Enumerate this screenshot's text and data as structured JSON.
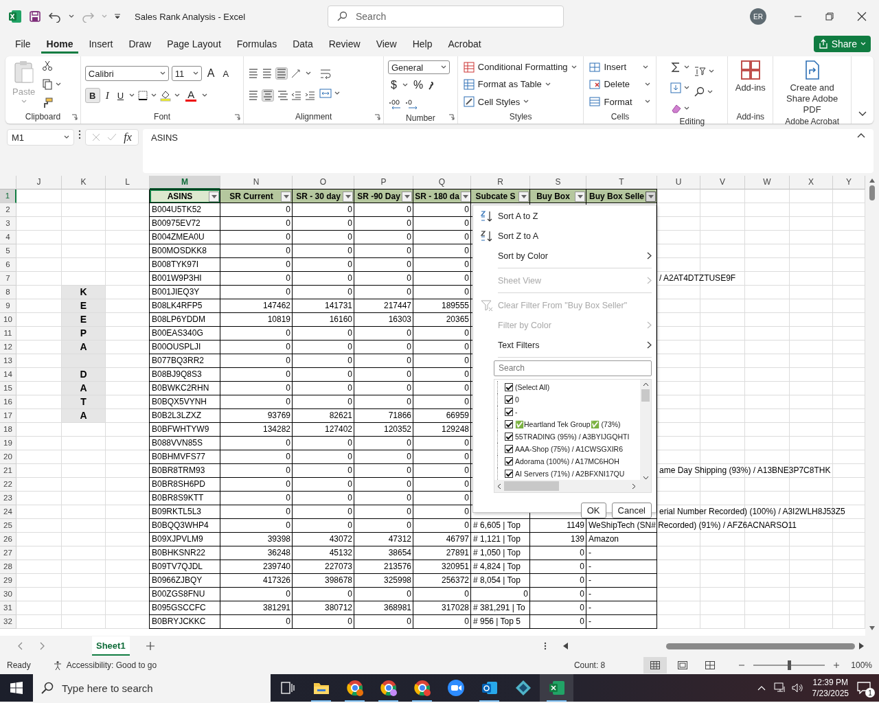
{
  "window": {
    "title": "Sales Rank Analysis - Excel",
    "search_placeholder": "Search",
    "account_initials": "ER"
  },
  "ribbon_tabs": [
    {
      "label": "File",
      "selected": false
    },
    {
      "label": "Home",
      "selected": true
    },
    {
      "label": "Insert",
      "selected": false
    },
    {
      "label": "Draw",
      "selected": false
    },
    {
      "label": "Page Layout",
      "selected": false
    },
    {
      "label": "Formulas",
      "selected": false
    },
    {
      "label": "Data",
      "selected": false
    },
    {
      "label": "Review",
      "selected": false
    },
    {
      "label": "View",
      "selected": false
    },
    {
      "label": "Help",
      "selected": false
    },
    {
      "label": "Acrobat",
      "selected": false
    }
  ],
  "share_button": "Share",
  "ribbon": {
    "clipboard": {
      "paste": "Paste",
      "paste_disabled": true,
      "label": "Clipboard"
    },
    "font": {
      "name": "Calibri",
      "size": "11",
      "grow": "A",
      "shrink": "A",
      "bold": "B",
      "italic": "I",
      "underline": "U",
      "font_color": "A",
      "label": "Font"
    },
    "alignment": {
      "label": "Alignment"
    },
    "number": {
      "format": "General",
      "currency": "$",
      "percent": "%",
      "label": "Number"
    },
    "styles": {
      "buttons": [
        "Conditional Formatting",
        "Format as Table",
        "Cell Styles"
      ],
      "label": "Styles"
    },
    "cells": {
      "buttons": [
        "Insert",
        "Delete",
        "Format"
      ],
      "label": "Cells"
    },
    "editing": {
      "label": "Editing"
    },
    "addins": {
      "button": "Add-ins",
      "label": "Add-ins"
    },
    "acrobat": {
      "button": "Create and Share Adobe PDF",
      "label": "Adobe Acrobat"
    }
  },
  "formula_bar": {
    "name_box": "M1",
    "function_label": "fx",
    "formula": "ASINS"
  },
  "sheet": {
    "columns": [
      {
        "label": "J",
        "selected": false
      },
      {
        "label": "K",
        "selected": false
      },
      {
        "label": "L",
        "selected": false
      },
      {
        "label": "M",
        "selected": true
      },
      {
        "label": "N",
        "selected": false
      },
      {
        "label": "O",
        "selected": false
      },
      {
        "label": "P",
        "selected": false
      },
      {
        "label": "Q",
        "selected": false
      },
      {
        "label": "R",
        "selected": false
      },
      {
        "label": "S",
        "selected": false
      },
      {
        "label": "T",
        "selected": false
      },
      {
        "label": "U",
        "selected": false
      },
      {
        "label": "V",
        "selected": false
      },
      {
        "label": "W",
        "selected": false
      },
      {
        "label": "X",
        "selected": false
      },
      {
        "label": "Y",
        "selected": false
      }
    ],
    "header_row": {
      "number": "1",
      "selected": true,
      "cells": [
        {
          "text": "ASINS",
          "active": true,
          "filter_open": false
        },
        {
          "text": "SR Current",
          "active": false,
          "filter_open": false
        },
        {
          "text": "SR - 30 day",
          "active": false,
          "filter_open": false
        },
        {
          "text": "SR -90 Day",
          "active": false,
          "filter_open": false
        },
        {
          "text": "SR - 180 da",
          "active": false,
          "filter_open": false
        },
        {
          "text": "Subcate S",
          "active": false,
          "filter_open": false
        },
        {
          "text": "Buy Box",
          "active": false,
          "filter_open": false
        },
        {
          "text": "Buy Box Selle",
          "active": false,
          "filter_open": true
        }
      ]
    },
    "rows": [
      {
        "number": "2",
        "selected": false,
        "shaded": false,
        "cells": {
          "m": "B004U5TK52",
          "n": "0",
          "o": "0",
          "p": "0",
          "q": "0"
        }
      },
      {
        "number": "3",
        "selected": false,
        "shaded": false,
        "cells": {
          "m": "B00975EV72",
          "n": "0",
          "o": "0",
          "p": "0",
          "q": "0"
        }
      },
      {
        "number": "4",
        "selected": false,
        "shaded": false,
        "cells": {
          "m": "B004ZMEA0U",
          "n": "0",
          "o": "0",
          "p": "0",
          "q": "0"
        }
      },
      {
        "number": "5",
        "selected": false,
        "shaded": false,
        "cells": {
          "m": "B00MOSDKK8",
          "n": "0",
          "o": "0",
          "p": "0",
          "q": "0"
        }
      },
      {
        "number": "6",
        "selected": false,
        "shaded": false,
        "cells": {
          "m": "B008TYK97I",
          "n": "0",
          "o": "0",
          "p": "0",
          "q": "0"
        }
      },
      {
        "number": "7",
        "selected": false,
        "shaded": false,
        "cells": {
          "m": "B001W9P3HI",
          "n": "0",
          "o": "0",
          "p": "0",
          "q": "0",
          "u": "/ A2AT4DTZTUSE9F"
        }
      },
      {
        "number": "8",
        "selected": false,
        "shaded": true,
        "cells": {
          "k": "K",
          "m": "B001JIEQ3Y",
          "n": "0",
          "o": "0",
          "p": "0",
          "q": "0"
        }
      },
      {
        "number": "9",
        "selected": false,
        "shaded": true,
        "cells": {
          "k": "E",
          "m": "B08LK4RFP5",
          "n": "147462",
          "o": "141731",
          "p": "217447",
          "q": "189555"
        }
      },
      {
        "number": "10",
        "selected": false,
        "shaded": true,
        "cells": {
          "k": "E",
          "m": "B08LP6YDDM",
          "n": "10819",
          "o": "16160",
          "p": "16303",
          "q": "20365"
        }
      },
      {
        "number": "11",
        "selected": false,
        "shaded": true,
        "cells": {
          "k": "P",
          "m": "B00EAS340G",
          "n": "0",
          "o": "0",
          "p": "0",
          "q": "0"
        }
      },
      {
        "number": "12",
        "selected": false,
        "shaded": true,
        "cells": {
          "k": "A",
          "m": "B00OUSPLJI",
          "n": "0",
          "o": "0",
          "p": "0",
          "q": "0"
        }
      },
      {
        "number": "13",
        "selected": false,
        "shaded": true,
        "cells": {
          "m": "B077BQ3RR2",
          "n": "0",
          "o": "0",
          "p": "0",
          "q": "0"
        }
      },
      {
        "number": "14",
        "selected": false,
        "shaded": true,
        "cells": {
          "k": "D",
          "m": "B08BJ9Q8S3",
          "n": "0",
          "o": "0",
          "p": "0",
          "q": "0"
        }
      },
      {
        "number": "15",
        "selected": false,
        "shaded": true,
        "cells": {
          "k": "A",
          "m": "B0BWKC2RHN",
          "n": "0",
          "o": "0",
          "p": "0",
          "q": "0"
        }
      },
      {
        "number": "16",
        "selected": false,
        "shaded": true,
        "cells": {
          "k": "T",
          "m": "B0BQX5VYNH",
          "n": "0",
          "o": "0",
          "p": "0",
          "q": "0"
        }
      },
      {
        "number": "17",
        "selected": false,
        "shaded": true,
        "cells": {
          "k": "A",
          "m": "B0B2L3LZXZ",
          "n": "93769",
          "o": "82621",
          "p": "71866",
          "q": "66959"
        }
      },
      {
        "number": "18",
        "selected": false,
        "shaded": false,
        "cells": {
          "m": "B0BFWHTYW9",
          "n": "134282",
          "o": "127402",
          "p": "120352",
          "q": "129248"
        }
      },
      {
        "number": "19",
        "selected": false,
        "shaded": false,
        "cells": {
          "m": "B088VVN85S",
          "n": "0",
          "o": "0",
          "p": "0",
          "q": "0"
        }
      },
      {
        "number": "20",
        "selected": false,
        "shaded": false,
        "cells": {
          "m": "B0BHMVFS77",
          "n": "0",
          "o": "0",
          "p": "0",
          "q": "0"
        }
      },
      {
        "number": "21",
        "selected": false,
        "shaded": false,
        "cells": {
          "m": "B0BR8TRM93",
          "n": "0",
          "o": "0",
          "p": "0",
          "q": "0",
          "u": "ame Day Shipping (93%) / A13BNE3P7C8THK"
        }
      },
      {
        "number": "22",
        "selected": false,
        "shaded": false,
        "cells": {
          "m": "B0BR8SH6PD",
          "n": "0",
          "o": "0",
          "p": "0",
          "q": "0"
        }
      },
      {
        "number": "23",
        "selected": false,
        "shaded": false,
        "cells": {
          "m": "B0BR8S9KTT",
          "n": "0",
          "o": "0",
          "p": "0",
          "q": "0"
        }
      },
      {
        "number": "24",
        "selected": false,
        "shaded": false,
        "cells": {
          "m": "B09RKTL5L3",
          "n": "0",
          "o": "0",
          "p": "0",
          "q": "0",
          "u": "erial Number Recorded) (100%) / A3I2WLH8J53Z5"
        }
      },
      {
        "number": "25",
        "selected": false,
        "shaded": false,
        "cells": {
          "m": "B0BQQ3WHP4",
          "n": "0",
          "o": "0",
          "p": "0",
          "q": "0",
          "r": "# 6,605 | Top",
          "s": "1149",
          "t": "WeShipTech (SN# Recorded) (91%) / AFZ6ACNARSO11"
        }
      },
      {
        "number": "26",
        "selected": false,
        "shaded": false,
        "cells": {
          "m": "B09XJPVLM9",
          "n": "39398",
          "o": "43072",
          "p": "47312",
          "q": "46797",
          "r": "# 1,121 | Top",
          "s": "139",
          "t": "Amazon"
        }
      },
      {
        "number": "27",
        "selected": false,
        "shaded": false,
        "cells": {
          "m": "B0BHKSNR22",
          "n": "36248",
          "o": "45132",
          "p": "38654",
          "q": "27891",
          "r": "# 1,050 | Top",
          "s": "0",
          "t": "-"
        }
      },
      {
        "number": "28",
        "selected": false,
        "shaded": false,
        "cells": {
          "m": "B09TV7QJDL",
          "n": "239740",
          "o": "227073",
          "p": "213576",
          "q": "320951",
          "r": "# 4,824 | Top",
          "s": "0",
          "t": "-"
        }
      },
      {
        "number": "29",
        "selected": false,
        "shaded": false,
        "cells": {
          "m": "B0966ZJBQY",
          "n": "417326",
          "o": "398678",
          "p": "325998",
          "q": "256372",
          "r": "# 8,054 | Top",
          "s": "0",
          "t": "-"
        }
      },
      {
        "number": "30",
        "selected": false,
        "shaded": false,
        "r_numeric": true,
        "cells": {
          "m": "B00ZGS8FNU",
          "n": "0",
          "o": "0",
          "p": "0",
          "q": "0",
          "r": "0",
          "s": "0",
          "t": "-"
        }
      },
      {
        "number": "31",
        "selected": false,
        "shaded": false,
        "cells": {
          "m": "B095GSCCFC",
          "n": "381291",
          "o": "380712",
          "p": "368981",
          "q": "317028",
          "r": "# 381,291 | To",
          "s": "0",
          "t": "-"
        }
      },
      {
        "number": "32",
        "selected": false,
        "shaded": false,
        "cells": {
          "m": "B0BRYJCKKC",
          "n": "0",
          "o": "0",
          "p": "0",
          "q": "0",
          "r": "# 956 | Top 5",
          "s": "0",
          "t": "-"
        }
      }
    ]
  },
  "filter_menu": {
    "items": [
      {
        "kind": "sort-asc",
        "label": "Sort A to Z",
        "disabled": false
      },
      {
        "kind": "sort-desc",
        "label": "Sort Z to A",
        "disabled": false
      },
      {
        "kind": "submenu",
        "label": "Sort by Color",
        "disabled": false
      },
      {
        "kind": "separator"
      },
      {
        "kind": "submenu",
        "label": "Sheet View",
        "disabled": true
      },
      {
        "kind": "separator"
      },
      {
        "kind": "clear-filter",
        "label": "Clear Filter From \"Buy Box Seller\"",
        "disabled": true
      },
      {
        "kind": "submenu",
        "label": "Filter by Color",
        "disabled": true
      },
      {
        "kind": "submenu",
        "label": "Text Filters",
        "disabled": false
      },
      {
        "kind": "separator"
      }
    ],
    "search_placeholder": "Search",
    "values": [
      {
        "label": "(Select All)",
        "checked": true
      },
      {
        "label": "0",
        "checked": true
      },
      {
        "label": "-",
        "checked": true
      },
      {
        "label": "✅Heartland Tek Group✅ (73%)",
        "checked": true
      },
      {
        "label": "55TRADING (95%) / A3BYIJGQHTI",
        "checked": true
      },
      {
        "label": "AAA-Shop (75%) / A1CWSGXIR6",
        "checked": true
      },
      {
        "label": "Adorama (100%) / A17MC6HOH",
        "checked": true
      },
      {
        "label": "AI Servers (71%) / A2BFXNI17QU",
        "checked": true
      }
    ],
    "buttons": [
      "OK",
      "Cancel"
    ]
  },
  "sheet_tabs": [
    {
      "label": "Sheet1",
      "selected": true
    }
  ],
  "status_bar": {
    "mode": "Ready",
    "accessibility": "Accessibility: Good to go",
    "count": "Count: 8",
    "zoom": "100%",
    "zoom_slider": {
      "level": 0.5
    }
  },
  "taskbar": {
    "search_placeholder": "Type here to search",
    "time": "12:39 PM",
    "date": "7/23/2025",
    "notifications": "1"
  }
}
